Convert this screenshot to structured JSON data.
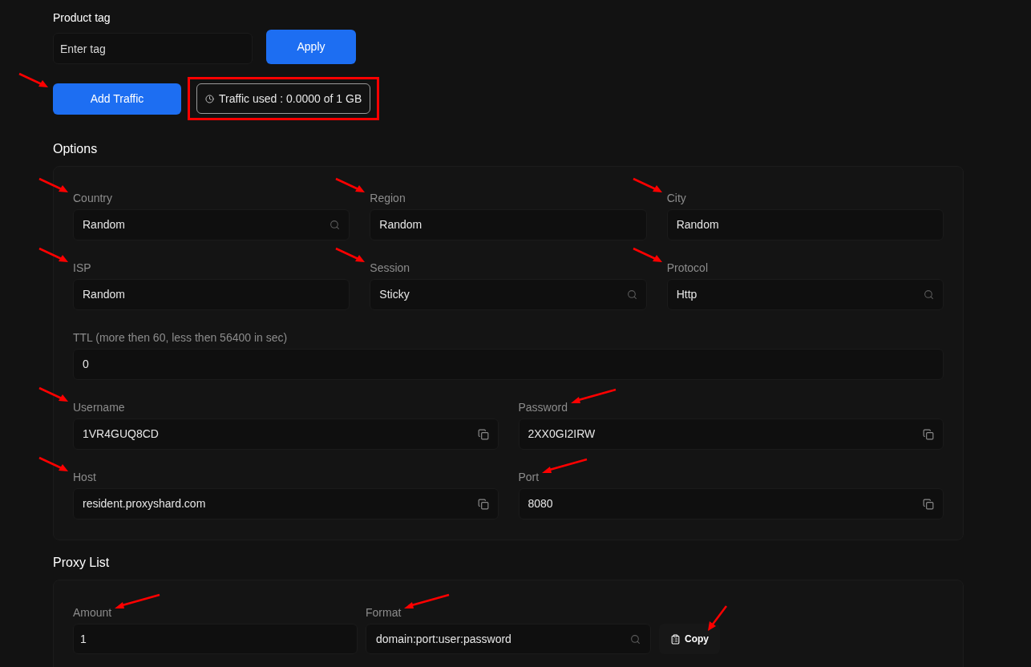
{
  "product_tag": {
    "label": "Product tag",
    "placeholder": "Enter tag",
    "apply_button": "Apply"
  },
  "add_traffic": {
    "label": "Add Traffic",
    "arrow": true
  },
  "traffic_used": {
    "text": "Traffic used : 0.0000 of 1 GB",
    "highlighted": true
  },
  "options": {
    "heading": "Options",
    "rows": [
      [
        {
          "label": "Country",
          "value": "Random",
          "kind": "search",
          "arrow": true,
          "arrow_from_right": false
        },
        {
          "label": "Region",
          "value": "Random",
          "kind": "text",
          "arrow": true,
          "arrow_from_right": false
        },
        {
          "label": "City",
          "value": "Random",
          "kind": "text",
          "arrow": true,
          "arrow_from_right": false
        }
      ],
      [
        {
          "label": "ISP",
          "value": "Random",
          "kind": "text",
          "arrow": true,
          "arrow_from_right": false
        },
        {
          "label": "Session",
          "value": "Sticky",
          "kind": "search",
          "arrow": true,
          "arrow_from_right": false
        },
        {
          "label": "Protocol",
          "value": "Http",
          "kind": "search",
          "arrow": true,
          "arrow_from_right": false
        }
      ],
      [
        {
          "label": "TTL (more then 60, less then 56400 in sec)",
          "value": "0",
          "kind": "text",
          "arrow": false
        }
      ],
      [
        {
          "label": "Username",
          "value": "1VR4GUQ8CD",
          "kind": "copy",
          "arrow": true,
          "arrow_from_right": false
        },
        {
          "label": "Password",
          "value": "2XX0GI2IRW",
          "kind": "copy",
          "arrow": true,
          "arrow_from_right": true
        }
      ],
      [
        {
          "label": "Host",
          "value": "resident.proxyshard.com",
          "kind": "copy",
          "arrow": true,
          "arrow_from_right": false
        },
        {
          "label": "Port",
          "value": "8080",
          "kind": "copy",
          "arrow": true,
          "arrow_from_right": true
        }
      ]
    ]
  },
  "proxy_list": {
    "heading": "Proxy List",
    "amount": {
      "label": "Amount",
      "value": "1",
      "arrow": true,
      "arrow_from_right": true
    },
    "format": {
      "label": "Format",
      "value": "domain:port:user:password",
      "arrow": true,
      "arrow_from_right": true
    },
    "copy_button": {
      "label": "Copy",
      "arrow": true
    }
  }
}
